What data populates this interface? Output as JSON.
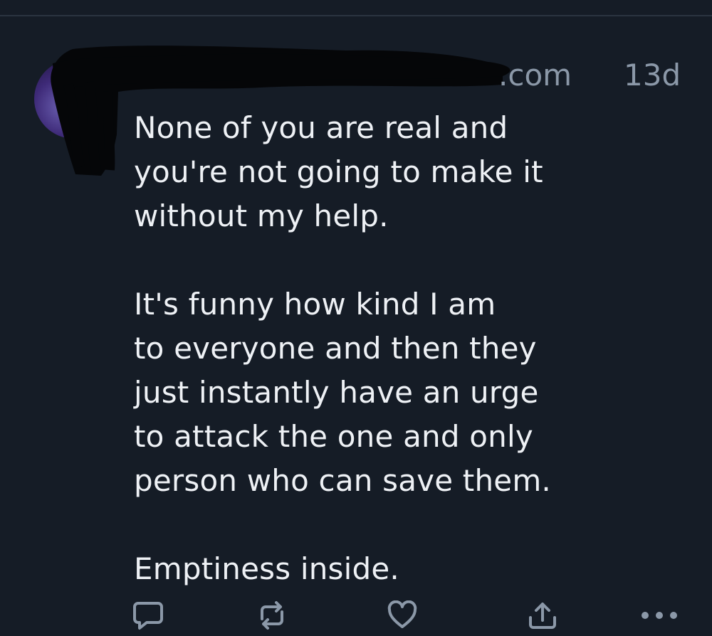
{
  "post": {
    "handle_suffix": ".com",
    "timestamp": "13d",
    "text": "None of you are real and\nyou're not going to make it\nwithout my help.\n\nIt's funny how kind I am\nto everyone and then they\njust instantly have an urge\nto attack the one and only\nperson who can save them.\n\nEmptiness inside."
  },
  "actions": {
    "reply_icon": "speech-bubble-icon",
    "repost_icon": "repost-arrows-icon",
    "like_icon": "heart-icon",
    "share_icon": "share-upload-icon",
    "more_icon": "more-dots-icon"
  },
  "colors": {
    "background": "#151c26",
    "text": "#eef1f5",
    "muted": "#8b98a8",
    "icon": "#8b98a8"
  }
}
